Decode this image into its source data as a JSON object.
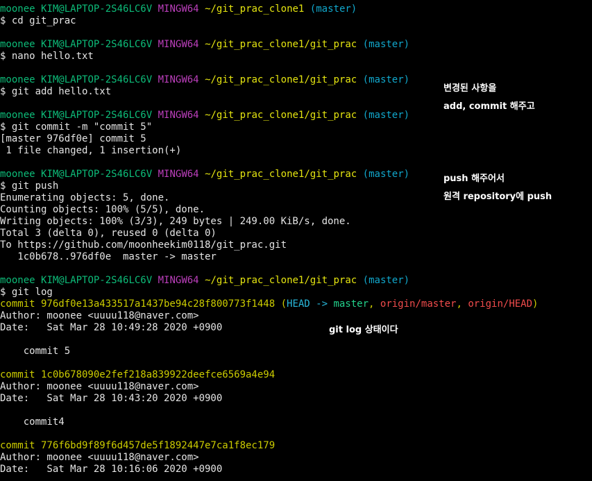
{
  "prompt": {
    "user": "moonee",
    "host": "KIM@LAPTOP-2S46LC6V",
    "shell": "MINGW64",
    "branch": "(master)",
    "path_clone": "~/git_prac_clone1",
    "path_prac": "~/git_prac_clone1/git_prac"
  },
  "commands": {
    "cd": "$ cd git_prac",
    "nano": "$ nano hello.txt",
    "add": "$ git add hello.txt",
    "commit": "$ git commit -m \"commit 5\"",
    "push": "$ git push",
    "log": "$ git log"
  },
  "commit_output": [
    "[master 976df0e] commit 5",
    " 1 file changed, 1 insertion(+)"
  ],
  "push_output": [
    "Enumerating objects: 5, done.",
    "Counting objects: 100% (5/5), done.",
    "Writing objects: 100% (3/3), 249 bytes | 249.00 KiB/s, done.",
    "Total 3 (delta 0), reused 0 (delta 0)",
    "To https://github.com/moonheekim0118/git_prac.git",
    "   1c0b678..976df0e  master -> master"
  ],
  "log": [
    {
      "hash_line": "commit 976df0e13a433517a1437be94c28f800773f1448",
      "refs": {
        "open": " (",
        "head": "HEAD -> ",
        "master": "master",
        "sep1": ", ",
        "origin_master": "origin/master",
        "sep2": ", ",
        "origin_head": "origin/HEAD",
        "close": ")"
      },
      "author": "Author: moonee <uuuu118@naver.com>",
      "date": "Date:   Sat Mar 28 10:49:28 2020 +0900",
      "message": "    commit 5"
    },
    {
      "hash_line": "commit 1c0b678090e2fef218a839922deefce6569a4e94",
      "author": "Author: moonee <uuuu118@naver.com>",
      "date": "Date:   Sat Mar 28 10:43:20 2020 +0900",
      "message": "    commit4"
    },
    {
      "hash_line": "commit 776f6bd9f89f6d457de5f1892447e7ca1f8ec179",
      "author": "Author: moonee <uuuu118@naver.com>",
      "date": "Date:   Sat Mar 28 10:16:06 2020 +0900"
    }
  ],
  "annotations": {
    "note1_line1": "변경된 사항을",
    "note1_line2": "add, commit 해주고",
    "note2_line1": "push 해주어서",
    "note2_line2": "원격 repository에 push",
    "note3": "git log 상태이다"
  },
  "colors": {
    "background": "#000000",
    "user": "#0dbc79",
    "shell": "#bc3fbc",
    "path": "#e5e510",
    "branch": "#11a8cd",
    "commit_hash": "#cdcd00",
    "origin_ref": "#f14c4c"
  }
}
